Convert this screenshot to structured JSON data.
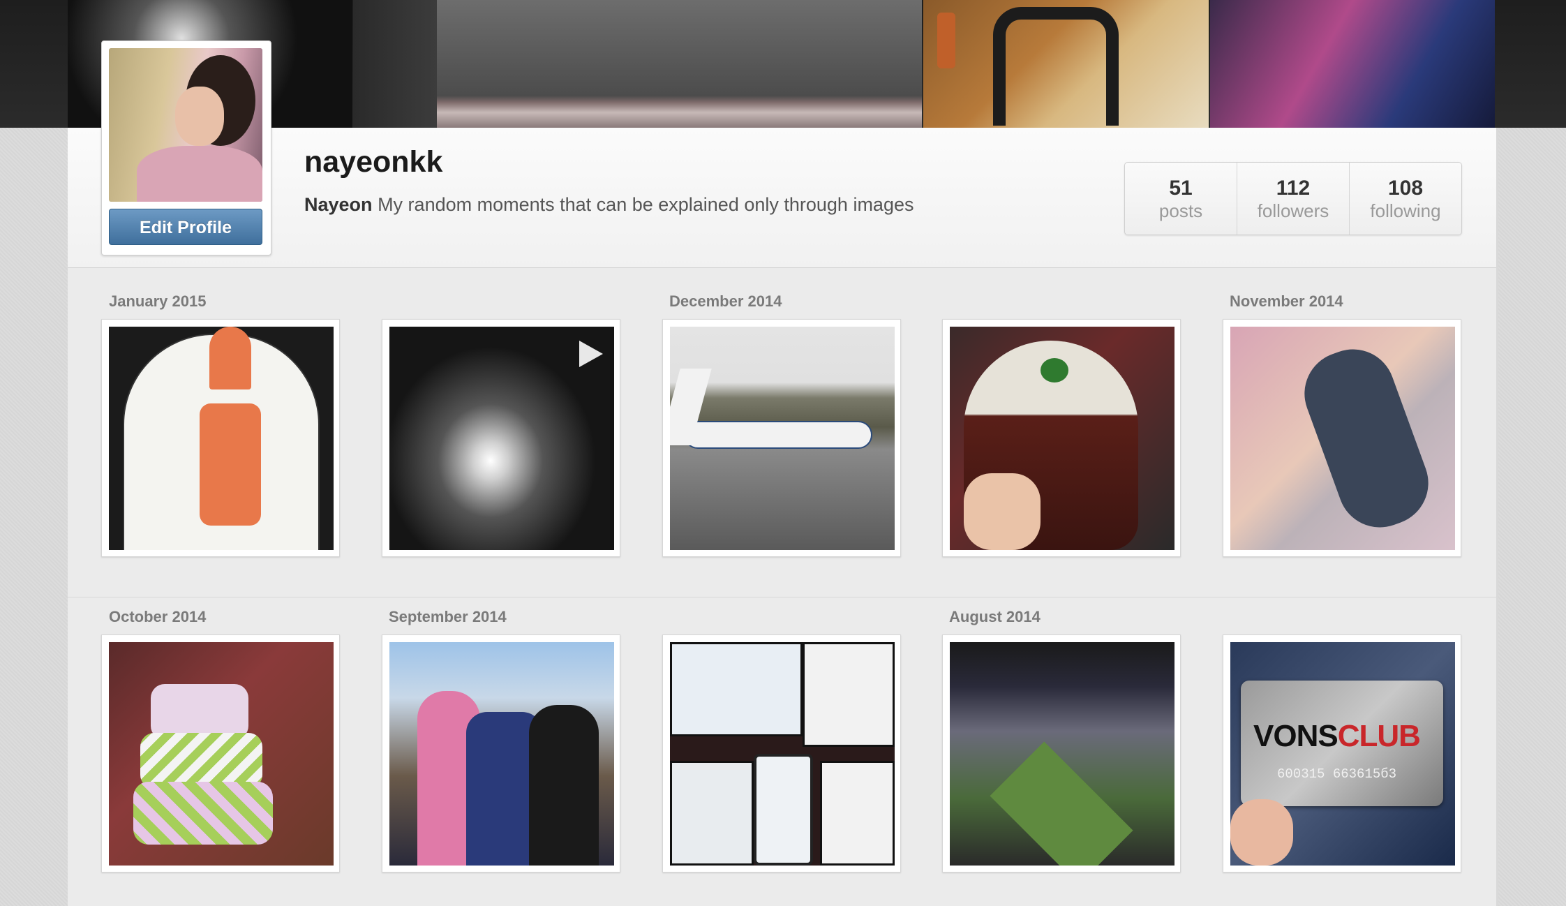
{
  "profile": {
    "username": "nayeonkk",
    "full_name": "Nayeon",
    "bio": "My random moments that can be explained only through images",
    "edit_button": "Edit Profile"
  },
  "stats": {
    "posts": {
      "count": "51",
      "label": "posts"
    },
    "followers": {
      "count": "112",
      "label": "followers"
    },
    "following": {
      "count": "108",
      "label": "following"
    }
  },
  "months": {
    "row1": [
      "January 2015",
      "December 2014",
      "November 2014"
    ],
    "row2": [
      "October 2014",
      "September 2014",
      "August 2014"
    ]
  },
  "photos": {
    "vons_card_number": "600315 663615б3",
    "vons_brand": "VONS",
    "vons_club": "CLUB"
  }
}
